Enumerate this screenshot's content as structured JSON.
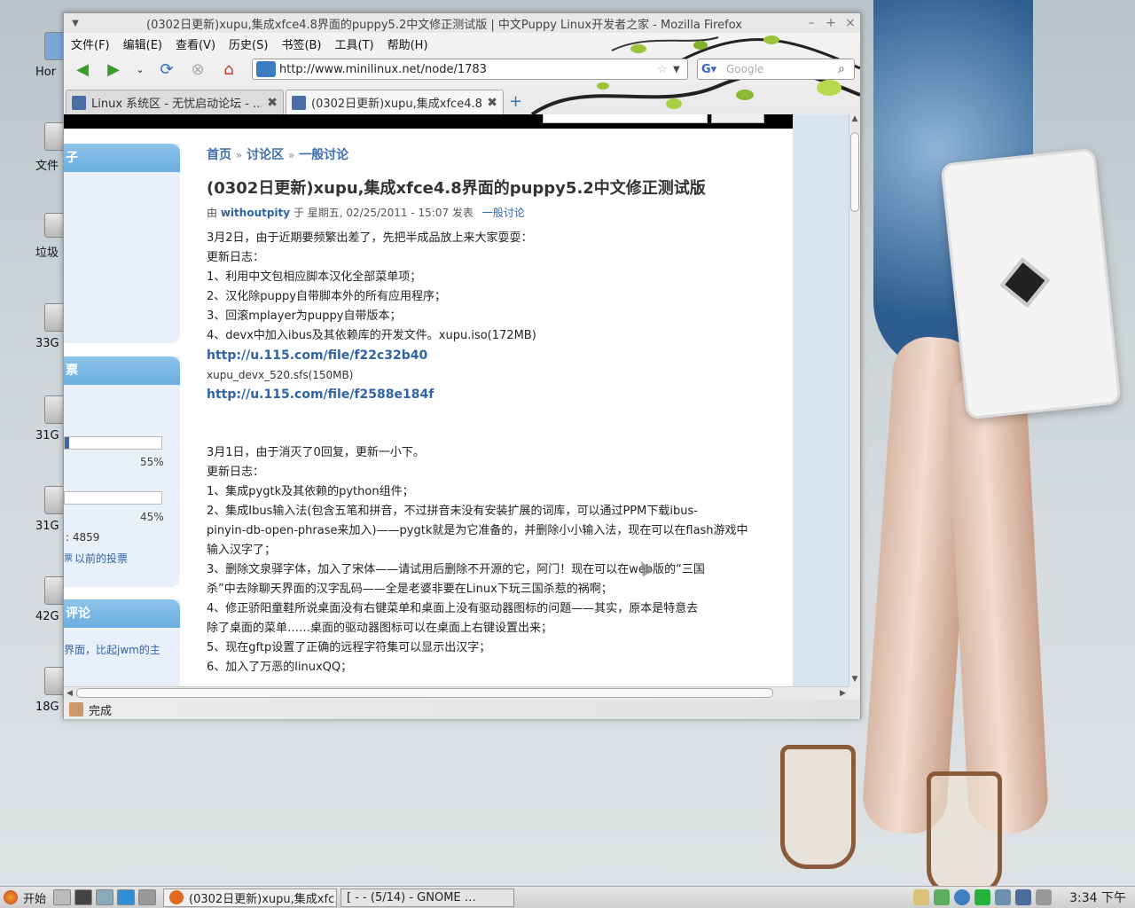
{
  "window": {
    "title": "(0302日更新)xupu,集成xfce4.8界面的puppy5.2中文修正测试版 | 中文Puppy Linux开发者之家 - Mozilla Firefox",
    "menu": [
      "文件(F)",
      "编辑(E)",
      "查看(V)",
      "历史(S)",
      "书签(B)",
      "工具(T)",
      "帮助(H)"
    ],
    "url": "http://www.minilinux.net/node/1783",
    "search_placeholder": "Google",
    "tabs": [
      {
        "title": "Linux 系统区 - 无忧启动论坛 - ...",
        "active": false
      },
      {
        "title": "(0302日更新)xupu,集成xfce4.8...",
        "active": true
      }
    ],
    "status": "完成"
  },
  "desktop_icons": [
    "Hor",
    "文件",
    "垃圾",
    "33G",
    "31G",
    "31G",
    "42G",
    "18G"
  ],
  "sidebar": {
    "box1_header": "子",
    "box2_header": "票",
    "poll": [
      {
        "fraction": 0.05,
        "pct": "55%"
      },
      {
        "fraction": 0.0,
        "pct": "45%"
      }
    ],
    "votes": ": 4859",
    "old_polls_prefix": "票",
    "old_polls": "以前的投票",
    "box3_header": "评论",
    "comment": "界面，比起jwm的主"
  },
  "breadcrumb": [
    "首页",
    "讨论区",
    "一般讨论"
  ],
  "node": {
    "title": "(0302日更新)xupu,集成xfce4.8界面的puppy5.2中文修正测试版",
    "by": "由",
    "author": "withoutpity",
    "date": "于 星期五, 02/25/2011 - 15:07 发表",
    "term": "一般讨论",
    "lines": [
      {
        "t": "3月2日，由于近期要频繁出差了，先把半成品放上来大家耍耍：",
        "k": ""
      },
      {
        "t": "更新日志：",
        "k": ""
      },
      {
        "t": "1、利用中文包相应脚本汉化全部菜单项；",
        "k": ""
      },
      {
        "t": "2、汉化除puppy自带脚本外的所有应用程序；",
        "k": ""
      },
      {
        "t": "3、回滚mplayer为puppy自带版本；",
        "k": ""
      },
      {
        "t": "4、devx中加入ibus及其依赖库的开发文件。xupu.iso(172MB)",
        "k": ""
      },
      {
        "t": "http://u.115.com/file/f22c32b40",
        "k": "link"
      },
      {
        "t": "xupu_devx_520.sfs(150MB)",
        "k": "small"
      },
      {
        "t": "http://u.115.com/file/f2588e184f",
        "k": "link"
      },
      {
        "t": "",
        "k": "blank"
      },
      {
        "t": "",
        "k": "blank"
      },
      {
        "t": "3月1日，由于消灭了0回复，更新一小下。",
        "k": ""
      },
      {
        "t": "更新日志：",
        "k": ""
      },
      {
        "t": "1、集成pygtk及其依赖的python组件；",
        "k": ""
      },
      {
        "t": "2、集成Ibus输入法(包含五笔和拼音，不过拼音未没有安装扩展的词库，可以通过PPM下载ibus-",
        "k": ""
      },
      {
        "t": "pinyin-db-open-phrase来加入)——pygtk就是为它准备的，并删除小小输入法，现在可以在flash游戏中",
        "k": ""
      },
      {
        "t": "输入汉字了；",
        "k": ""
      },
      {
        "t": "3、删除文泉驿字体，加入了宋体——请试用后删除不开源的它，阿门！现在可以在web版的“三国",
        "k": ""
      },
      {
        "t": "杀”中去除聊天界面的汉字乱码——全是老婆非要在Linux下玩三国杀惹的祸啊；",
        "k": ""
      },
      {
        "t": "4、修正骄阳童鞋所说桌面没有右键菜单和桌面上没有驱动器图标的问题——其实，原本是特意去",
        "k": ""
      },
      {
        "t": "除了桌面的菜单……桌面的驱动器图标可以在桌面上右键设置出来；",
        "k": ""
      },
      {
        "t": "5、现在gftp设置了正确的远程字符集可以显示出汉字；",
        "k": ""
      },
      {
        "t": "6、加入了万恶的linuxQQ；",
        "k": ""
      }
    ]
  },
  "taskbar": {
    "start": "开始",
    "tasks": [
      "(0302日更新)xupu,集成xfc…",
      "[ - - (5/14) - GNOME …"
    ],
    "clock": "3:34 下午"
  }
}
